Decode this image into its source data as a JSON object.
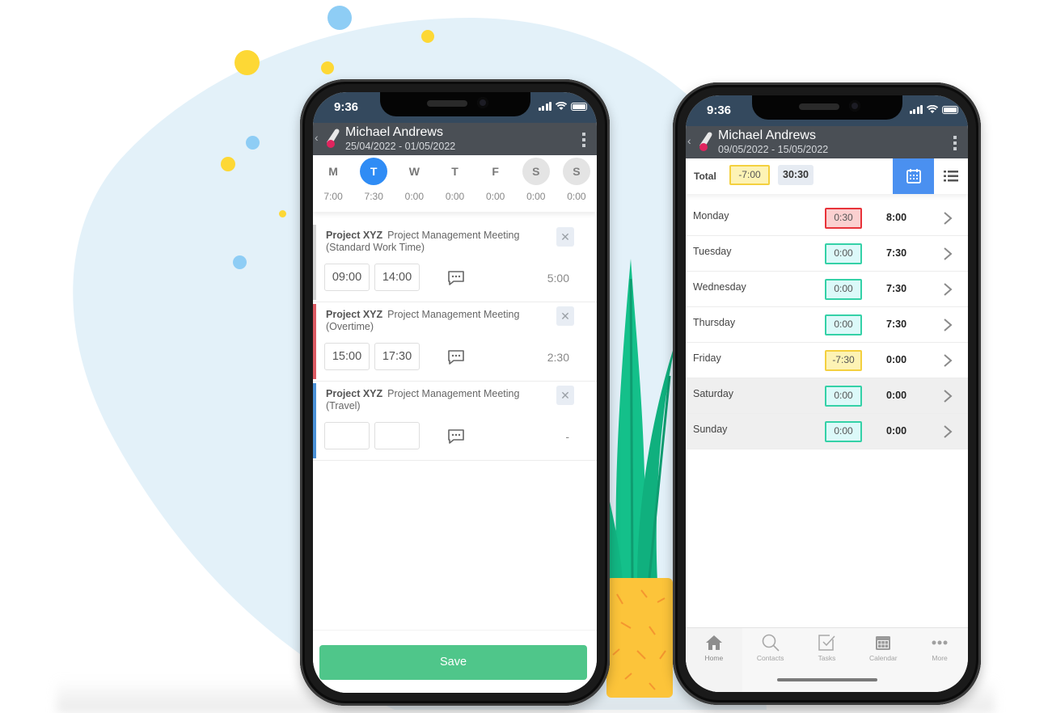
{
  "colors": {
    "brand_dark": "#34495e",
    "appbar": "#4a4f55",
    "accent_blue": "#2f8cf5",
    "save_green": "#4fc68a",
    "badge_red": "#e8333a",
    "badge_teal": "#34d1a7",
    "badge_yellow": "#f4d03f"
  },
  "left_phone": {
    "status_time": "9:36",
    "header": {
      "back_icon": "chevron-left-icon",
      "logo": "app-logo",
      "name": "Michael Andrews",
      "date_range": "25/04/2022 - 01/05/2022",
      "menu_icon": "kebab-menu-icon"
    },
    "week": [
      {
        "letter": "M",
        "hours": "7:00",
        "state": "normal"
      },
      {
        "letter": "T",
        "hours": "7:30",
        "state": "active"
      },
      {
        "letter": "W",
        "hours": "0:00",
        "state": "normal"
      },
      {
        "letter": "T",
        "hours": "0:00",
        "state": "normal"
      },
      {
        "letter": "F",
        "hours": "0:00",
        "state": "normal"
      },
      {
        "letter": "S",
        "hours": "0:00",
        "state": "weekend"
      },
      {
        "letter": "S",
        "hours": "0:00",
        "state": "weekend"
      }
    ],
    "entries": [
      {
        "project": "Project XYZ",
        "task": "Project Management Meeting",
        "type": "(Standard Work Time)",
        "start": "09:00",
        "end": "14:00",
        "duration": "5:00",
        "stripe_color": "#d4d4d4"
      },
      {
        "project": "Project XYZ",
        "task": "Project Management Meeting",
        "type": "(Overtime)",
        "start": "15:00",
        "end": "17:30",
        "duration": "2:30",
        "stripe_color": "#dc5a63"
      },
      {
        "project": "Project XYZ",
        "task": "Project Management Meeting",
        "type": "(Travel)",
        "start": "",
        "end": "",
        "duration": "-",
        "stripe_color": "#4a90d6"
      }
    ],
    "close_glyph": "✕",
    "save_label": "Save"
  },
  "right_phone": {
    "status_time": "9:36",
    "header": {
      "name": "Michael Andrews",
      "date_range": "09/05/2022 - 15/05/2022"
    },
    "totals": {
      "label": "Total",
      "difference": "-7:00",
      "sum": "30:30"
    },
    "days": [
      {
        "name": "Monday",
        "diff": "0:30",
        "status": "red",
        "total": "8:00",
        "weekend": false
      },
      {
        "name": "Tuesday",
        "diff": "0:00",
        "status": "teal",
        "total": "7:30",
        "weekend": false
      },
      {
        "name": "Wednesday",
        "diff": "0:00",
        "status": "teal",
        "total": "7:30",
        "weekend": false
      },
      {
        "name": "Thursday",
        "diff": "0:00",
        "status": "teal",
        "total": "7:30",
        "weekend": false
      },
      {
        "name": "Friday",
        "diff": "-7:30",
        "status": "yellow",
        "total": "0:00",
        "weekend": false
      },
      {
        "name": "Saturday",
        "diff": "0:00",
        "status": "teal",
        "total": "0:00",
        "weekend": true
      },
      {
        "name": "Sunday",
        "diff": "0:00",
        "status": "teal",
        "total": "0:00",
        "weekend": true
      }
    ],
    "tabs": [
      {
        "label": "Home",
        "icon": "home-icon",
        "active": true
      },
      {
        "label": "Contacts",
        "icon": "search-icon",
        "active": false
      },
      {
        "label": "Tasks",
        "icon": "tasks-check-icon",
        "active": false
      },
      {
        "label": "Calendar",
        "icon": "calendar-icon",
        "active": false
      },
      {
        "label": "More",
        "icon": "more-dots-icon",
        "active": false
      }
    ]
  }
}
